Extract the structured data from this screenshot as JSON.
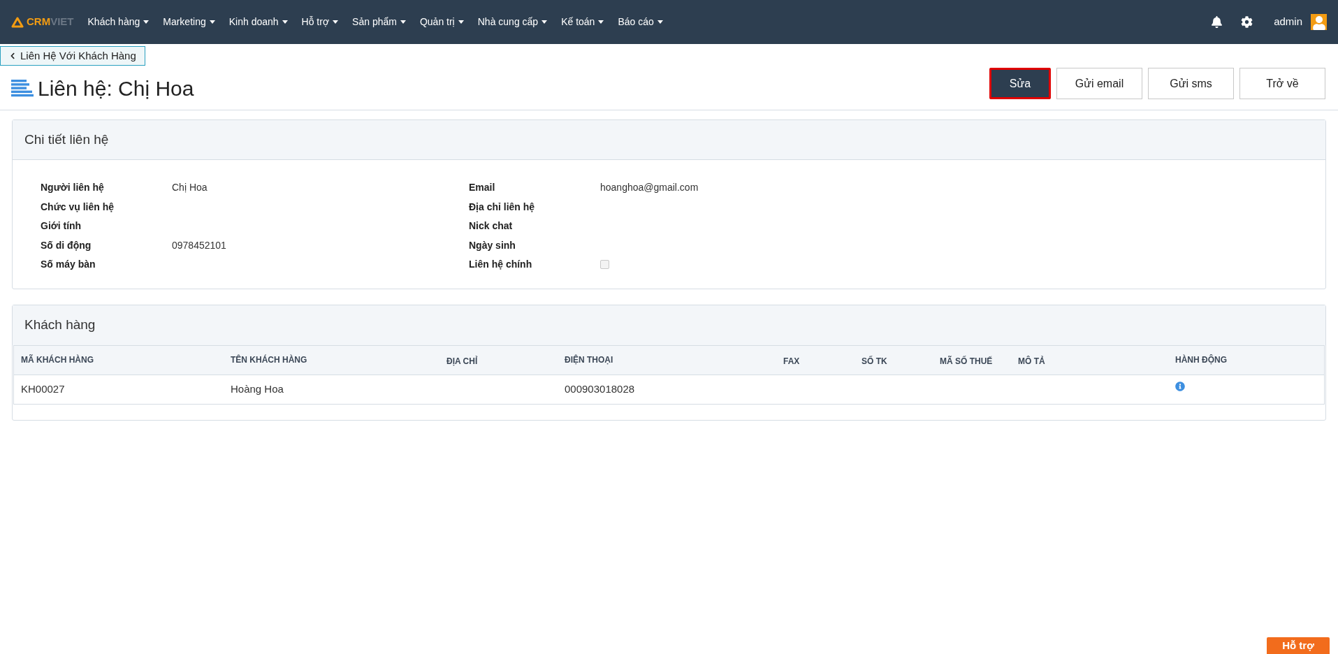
{
  "logo": {
    "part_1": "CRM",
    "part_2": "VIET"
  },
  "nav": [
    {
      "label": "Khách hàng"
    },
    {
      "label": "Marketing"
    },
    {
      "label": "Kinh doanh"
    },
    {
      "label": "Hỗ trợ"
    },
    {
      "label": "Sản phẩm"
    },
    {
      "label": "Quản trị"
    },
    {
      "label": "Nhà cung cấp"
    },
    {
      "label": "Kế toán"
    },
    {
      "label": "Báo cáo"
    }
  ],
  "user": {
    "name": "admin"
  },
  "breadcrumb": "Liên Hệ Với Khách Hàng",
  "title": "Liên hệ: Chị Hoa",
  "actions": [
    {
      "label": "Sửa",
      "kind": "primary",
      "focused": true
    },
    {
      "label": "Gửi email",
      "kind": "default",
      "focused": false
    },
    {
      "label": "Gửi sms",
      "kind": "default",
      "focused": false
    },
    {
      "label": "Trở về",
      "kind": "default",
      "focused": false
    }
  ],
  "details": {
    "title": "Chi tiết liên hệ",
    "left": [
      {
        "label": "Người liên hệ",
        "value": "Chị Hoa"
      },
      {
        "label": "Chức vụ liên hệ"
      },
      {
        "label": "Giới tính"
      },
      {
        "label": "Số di động",
        "value": "0978452101"
      },
      {
        "label": "Số máy bàn"
      }
    ],
    "right": [
      {
        "label": "Email",
        "value": "hoanghoa@gmail.com"
      },
      {
        "label": "Địa chỉ liên hệ"
      },
      {
        "label": "Nick chat"
      },
      {
        "label": "Ngày sinh"
      },
      {
        "label": "Liên hệ chính",
        "kind": "checkbox",
        "checked": false
      }
    ]
  },
  "customers": {
    "title": "Khách hàng",
    "columns": [
      "MÃ KHÁCH HÀNG",
      "TÊN KHÁCH HÀNG",
      "ĐỊA CHỈ",
      "ĐIỆN THOẠI",
      "FAX",
      "SỐ TK",
      "MÃ SỐ THUẾ",
      "MÔ TẢ",
      "HÀNH ĐỘNG"
    ],
    "rows": [
      [
        "KH00027",
        "Hoàng Hoa",
        "",
        "000903018028",
        "",
        "",
        "",
        "",
        ""
      ]
    ]
  },
  "help_button": "Hỗ trợ"
}
